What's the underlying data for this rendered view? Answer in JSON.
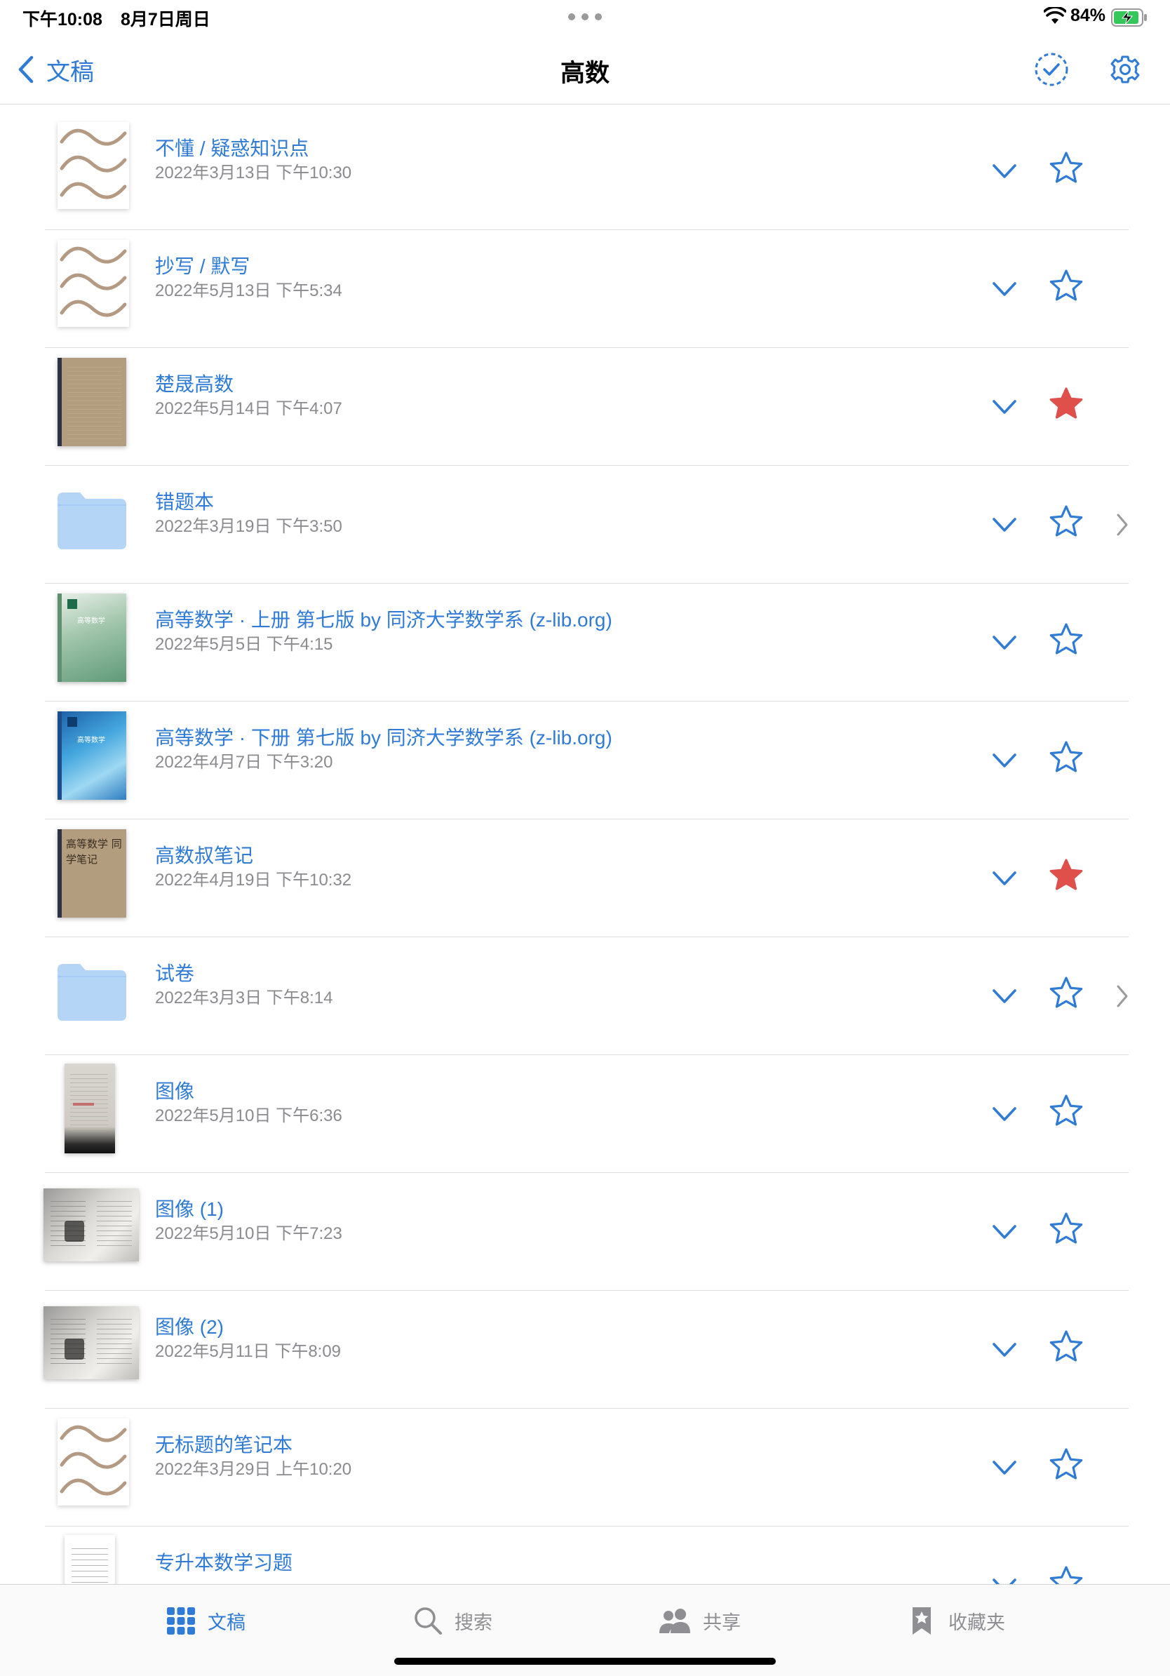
{
  "status_bar": {
    "time": "下午10:08",
    "date": "8月7日周日",
    "battery": "84%"
  },
  "nav": {
    "back_label": "文稿",
    "title": "高数"
  },
  "items": [
    {
      "title": "不懂 / 疑惑知识点",
      "date": "2022年3月13日 下午10:30",
      "thumb": "wave-notebook",
      "starred": false,
      "folder": false
    },
    {
      "title": "抄写 / 默写",
      "date": "2022年5月13日 下午5:34",
      "thumb": "wave-notebook",
      "starred": false,
      "folder": false
    },
    {
      "title": "楚晟高数",
      "date": "2022年5月14日 下午4:07",
      "thumb": "kraft-notebook",
      "starred": true,
      "folder": false
    },
    {
      "title": "错题本",
      "date": "2022年3月19日 下午3:50",
      "thumb": "folder",
      "starred": false,
      "folder": true
    },
    {
      "title": "高等数学 · 上册 第七版 by 同济大学数学系 (z-lib.org)",
      "date": "2022年5月5日 下午4:15",
      "thumb": "green-book",
      "starred": false,
      "folder": false,
      "cover_text": "高等数学"
    },
    {
      "title": "高等数学 · 下册 第七版 by 同济大学数学系 (z-lib.org)",
      "date": "2022年4月7日 下午3:20",
      "thumb": "blue-book",
      "starred": false,
      "folder": false,
      "cover_text": "高等数学"
    },
    {
      "title": "高数叔笔记",
      "date": "2022年4月19日 下午10:32",
      "thumb": "handwritten-book",
      "starred": true,
      "folder": false,
      "cover_text": "高等数学 同学笔记"
    },
    {
      "title": "试卷",
      "date": "2022年3月3日 下午8:14",
      "thumb": "folder",
      "starred": false,
      "folder": true
    },
    {
      "title": "图像",
      "date": "2022年5月10日 下午6:36",
      "thumb": "photo-portrait",
      "starred": false,
      "folder": false
    },
    {
      "title": "图像 (1)",
      "date": "2022年5月10日 下午7:23",
      "thumb": "photo-landscape",
      "starred": false,
      "folder": false
    },
    {
      "title": "图像 (2)",
      "date": "2022年5月11日 下午8:09",
      "thumb": "photo-landscape",
      "starred": false,
      "folder": false
    },
    {
      "title": "无标题的笔记本",
      "date": "2022年3月29日 上午10:20",
      "thumb": "wave-notebook",
      "starred": false,
      "folder": false
    },
    {
      "title": "专升本数学习题",
      "date": "",
      "thumb": "paper-doc",
      "starred": false,
      "folder": false
    }
  ],
  "tabs": [
    {
      "label": "文稿",
      "icon": "grid-icon",
      "active": true
    },
    {
      "label": "搜索",
      "icon": "search-icon",
      "active": false
    },
    {
      "label": "共享",
      "icon": "people-icon",
      "active": false
    },
    {
      "label": "收藏夹",
      "icon": "bookmark-star-icon",
      "active": false
    }
  ],
  "colors": {
    "accent": "#2f7bd6",
    "star_filled": "#e0504a",
    "folder": "#b5d5f7",
    "wave": "#b49a82"
  }
}
